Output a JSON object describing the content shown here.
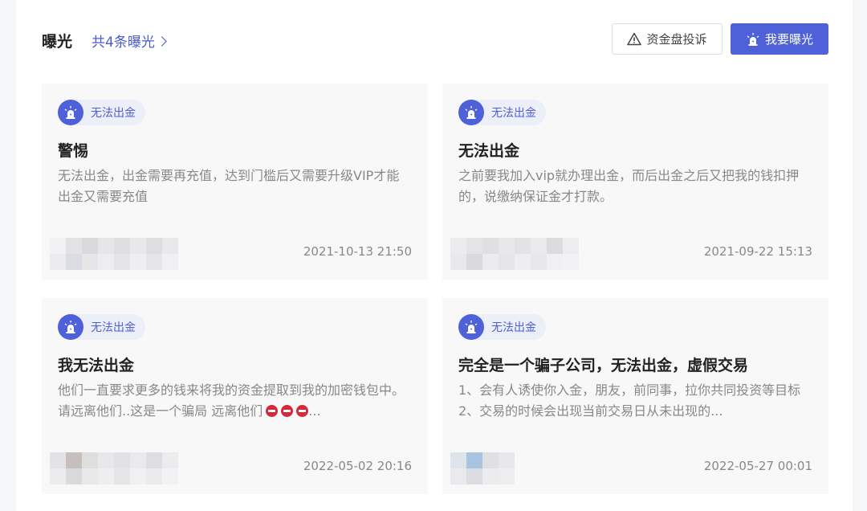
{
  "header": {
    "title": "曝光",
    "count_link": "共4条曝光",
    "complain_button": "资金盘投诉",
    "expose_button": "我要曝光"
  },
  "colors": {
    "accent": "#4e61d8",
    "stop_emoji": "#d6283b"
  },
  "cards": [
    {
      "tag": "无法出金",
      "title": "警惕",
      "desc": "无法出金，出金需要再充值，达到门槛后又需要升级VIP才能出金又需要充值",
      "time": "2021-10-13 21:50"
    },
    {
      "tag": "无法出金",
      "title": "无法出金",
      "desc": "之前要我加入vip就办理出金，而后出金之后又把我的钱扣押的，说缴纳保证金才打款。",
      "time": "2021-09-22 15:13"
    },
    {
      "tag": "无法出金",
      "title": "我无法出金",
      "desc": "他们一直要求更多的钱来将我的资金提取到我的加密钱包中。请远离他们..这是一个骗局 远离他们",
      "desc_suffix": "...",
      "time": "2022-05-02 20:16"
    },
    {
      "tag": "无法出金",
      "title": "完全是一个骗子公司，无法出金，虚假交易",
      "desc": "1、会有人诱使你入金，朋友，前同事，拉你共同投资等目标2、交易的时候会出现当前交易日从未出现的...",
      "time": "2022-05-27 00:01"
    }
  ]
}
